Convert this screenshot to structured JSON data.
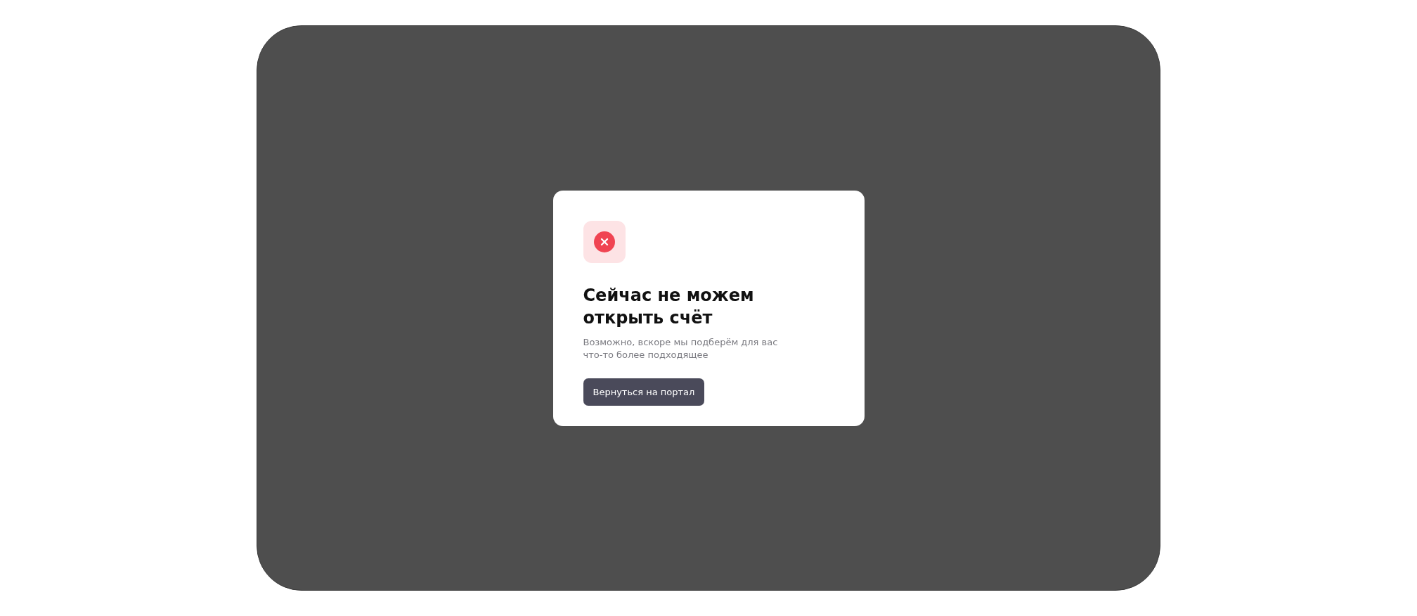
{
  "dialog": {
    "error": true,
    "title": "Сейчас не можем открыть счёт",
    "message": "Возможно, вскоре мы подберём для вас что-то более подходящее",
    "button": "Вернуться на портал"
  }
}
